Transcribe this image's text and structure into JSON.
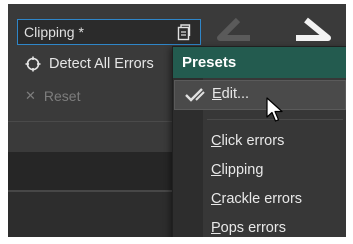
{
  "preset_field": {
    "value": "Clipping *",
    "icon": "preset-document-icon"
  },
  "actions": {
    "detect_all": {
      "label": "Detect All Errors",
      "icon": "crosshair-icon"
    },
    "reset": {
      "label": "Reset",
      "icon": "close-icon"
    }
  },
  "toolbar": {
    "previous": "arrow-left-icon",
    "next": "arrow-right-icon"
  },
  "menu": {
    "title": "Presets",
    "edit": {
      "prefix": "E",
      "rest": "dit...",
      "icon": "checkmark-edit-icon"
    },
    "items": [
      {
        "prefix": "C",
        "rest": "lick errors"
      },
      {
        "prefix": "C",
        "rest": "lipping"
      },
      {
        "prefix": "C",
        "rest": "rackle errors"
      },
      {
        "prefix": "P",
        "rest": "ops errors"
      }
    ]
  },
  "colors": {
    "accent": "#235b4f",
    "focus_border": "#2f86c8"
  }
}
